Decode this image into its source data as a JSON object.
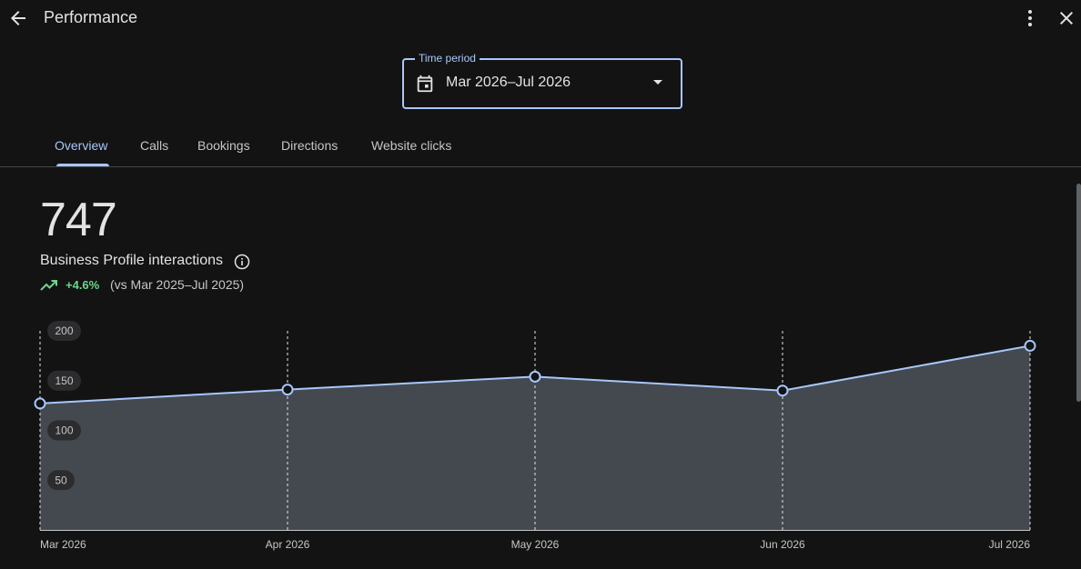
{
  "header": {
    "title": "Performance",
    "icons": {
      "back": "arrow-left-icon",
      "more": "more-vert-icon",
      "close": "close-icon"
    }
  },
  "time_period": {
    "label": "Time period",
    "value": "Mar 2026–Jul 2026",
    "icon": "calendar-icon"
  },
  "tabs": [
    {
      "label": "Overview",
      "active": true
    },
    {
      "label": "Calls",
      "active": false
    },
    {
      "label": "Bookings",
      "active": false
    },
    {
      "label": "Directions",
      "active": false
    },
    {
      "label": "Website clicks",
      "active": false
    }
  ],
  "summary": {
    "value": "747",
    "label": "Business Profile interactions",
    "change": "+4.6%",
    "comparison": "(vs Mar 2025–Jul 2025)"
  },
  "colors": {
    "accent": "#a8c7fa",
    "positive": "#6dd58c",
    "area_fill": "#444950",
    "background": "#131314"
  },
  "chart_data": {
    "type": "area",
    "categories": [
      "Mar 2026",
      "Apr 2026",
      "May 2026",
      "Jun 2026",
      "Jul 2026"
    ],
    "values": [
      127,
      141,
      154,
      140,
      185
    ],
    "ylim": [
      0,
      200
    ],
    "yticks": [
      50,
      100,
      150,
      200
    ],
    "grid": "vertical-dashed",
    "xlabel": "",
    "ylabel": ""
  }
}
